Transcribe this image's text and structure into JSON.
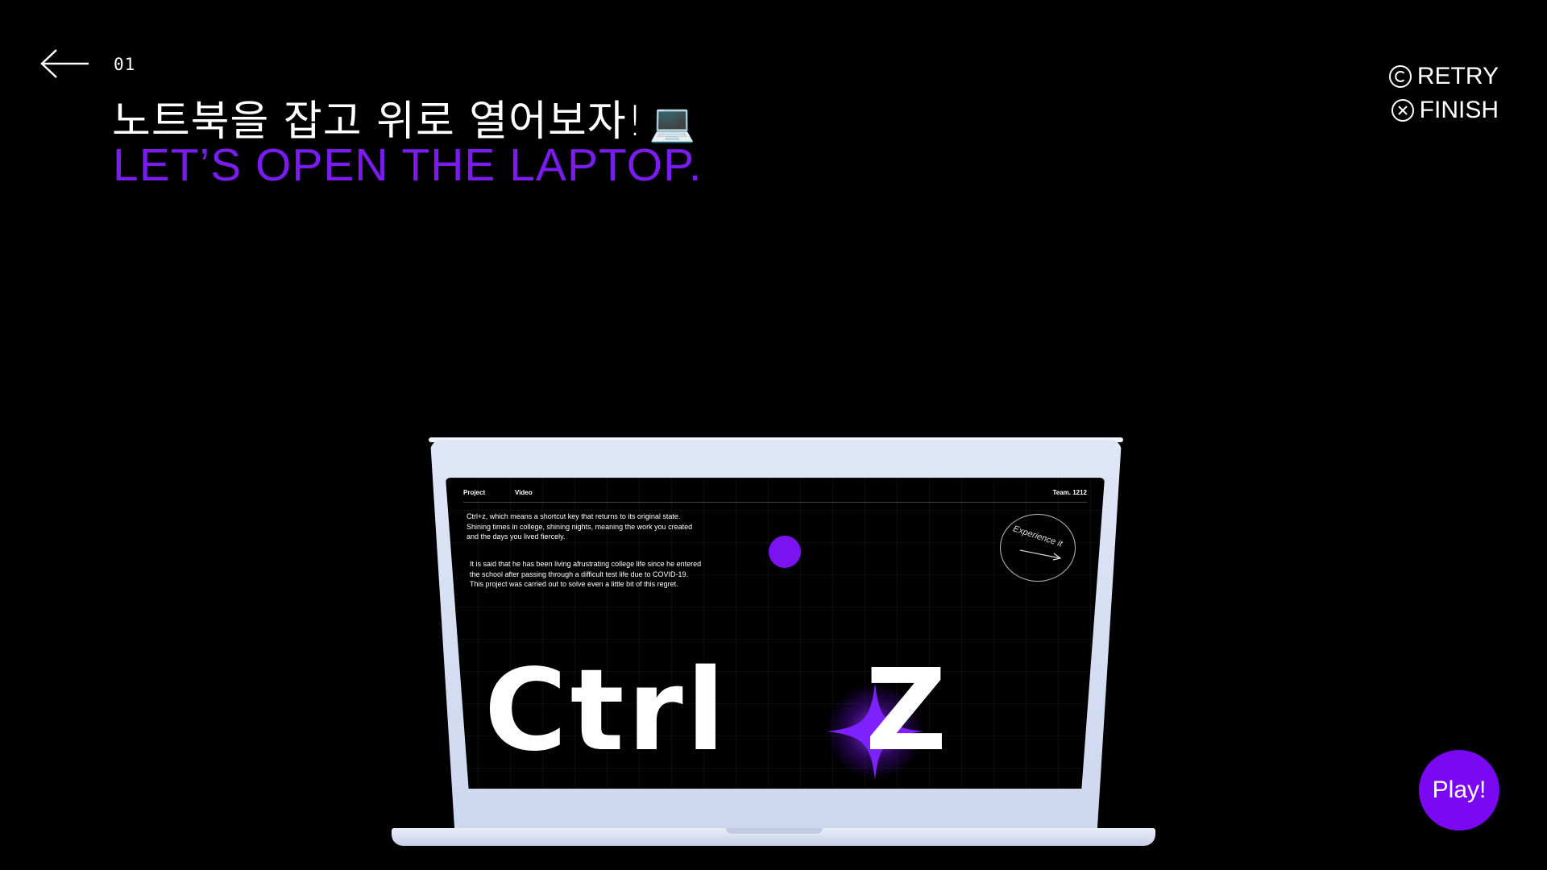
{
  "header": {
    "step": "01",
    "title_ko": "노트북을 잡고 위로 열어보자!",
    "title_emoji": "💻",
    "title_en": "LET’S OPEN THE LAPTOP.",
    "back_icon": "arrow-left-icon"
  },
  "controls": {
    "retry_label": "RETRY",
    "retry_icon": "copyright-circle-icon",
    "finish_label": "FINISH",
    "finish_icon": "close-circle-icon"
  },
  "laptop_screen": {
    "nav": {
      "project": "Project",
      "video": "Video",
      "team": "Team. 1212"
    },
    "paragraph_1": "Ctrl+z, which means a shortcut key that returns to its original state.\nShining times in college, shining nights, meaning the work you created\nand the days you lived fiercely.",
    "paragraph_2": "It is said that he has been living afrustrating college life since he entered\nthe school after passing through a difficult test life due to COVID-19.\nThis project was carried out to solve even a little bit of this regret.",
    "experience_label": "Experience it",
    "logo_left": "Ctrl",
    "logo_right": "Z"
  },
  "play_button": {
    "label": "Play!"
  },
  "colors": {
    "accent_purple": "#7a1bf0",
    "background": "#000000"
  }
}
